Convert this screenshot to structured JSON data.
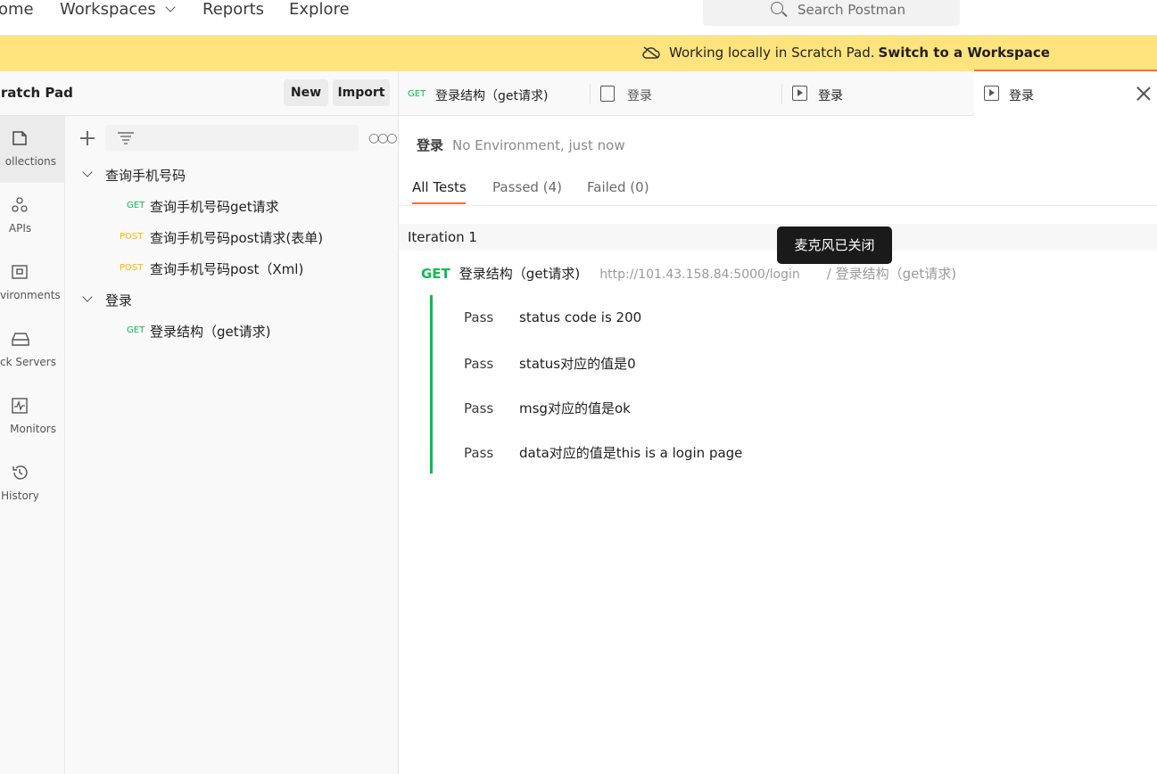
{
  "topnav": {
    "home": "ome",
    "workspaces": "Workspaces",
    "reports": "Reports",
    "explore": "Explore",
    "search_placeholder": "Search Postman"
  },
  "banner": {
    "text": "Working locally in Scratch Pad.",
    "link": "Switch to a Workspace",
    "bg_color": "#ffe47e"
  },
  "sidebar": {
    "title": "cratch Pad",
    "new_label": "New",
    "import_label": "Import",
    "icons": [
      {
        "label": "ollections",
        "icon": "collections-icon"
      },
      {
        "label": "APIs",
        "icon": "apis-icon"
      },
      {
        "label": "vironments",
        "icon": "environments-icon"
      },
      {
        "label": "ck Servers",
        "icon": "mock-servers-icon"
      },
      {
        "label": "Monitors",
        "icon": "monitors-icon"
      },
      {
        "label": "History",
        "icon": "history-icon"
      }
    ],
    "tree": [
      {
        "type": "folder",
        "name": "查询手机号码"
      },
      {
        "type": "request",
        "method": "GET",
        "name": "查询手机号码get请求"
      },
      {
        "type": "request",
        "method": "POST",
        "name": "查询手机号码post请求(表单)"
      },
      {
        "type": "request",
        "method": "POST",
        "name": "查询手机号码post（Xml)"
      },
      {
        "type": "folder",
        "name": "登录"
      },
      {
        "type": "request",
        "method": "GET",
        "name": "登录结构（get请求)"
      }
    ]
  },
  "tabs": [
    {
      "method": "GET",
      "label": "登录结构（get请求)"
    },
    {
      "label": "登录"
    },
    {
      "label": "登录"
    },
    {
      "label": "登录"
    }
  ],
  "main": {
    "env_name": "登录",
    "env_meta": "No Environment, just now",
    "result_tabs": [
      "All Tests",
      "Passed (4)",
      "Failed (0)"
    ],
    "iteration": "Iteration 1",
    "request": {
      "method": "GET",
      "name": "登录结构（get请求)",
      "url": "http://101.43.158.84:5000/login",
      "path": "/ 登录结构（get请求)"
    },
    "results": [
      {
        "status": "Pass",
        "name": "status code is 200"
      },
      {
        "status": "Pass",
        "name": "status对应的值是0"
      },
      {
        "status": "Pass",
        "name": "msg对应的值是ok"
      },
      {
        "status": "Pass",
        "name": "data对应的值是this is a login page"
      }
    ]
  },
  "tooltip": "麦克风已关闭"
}
